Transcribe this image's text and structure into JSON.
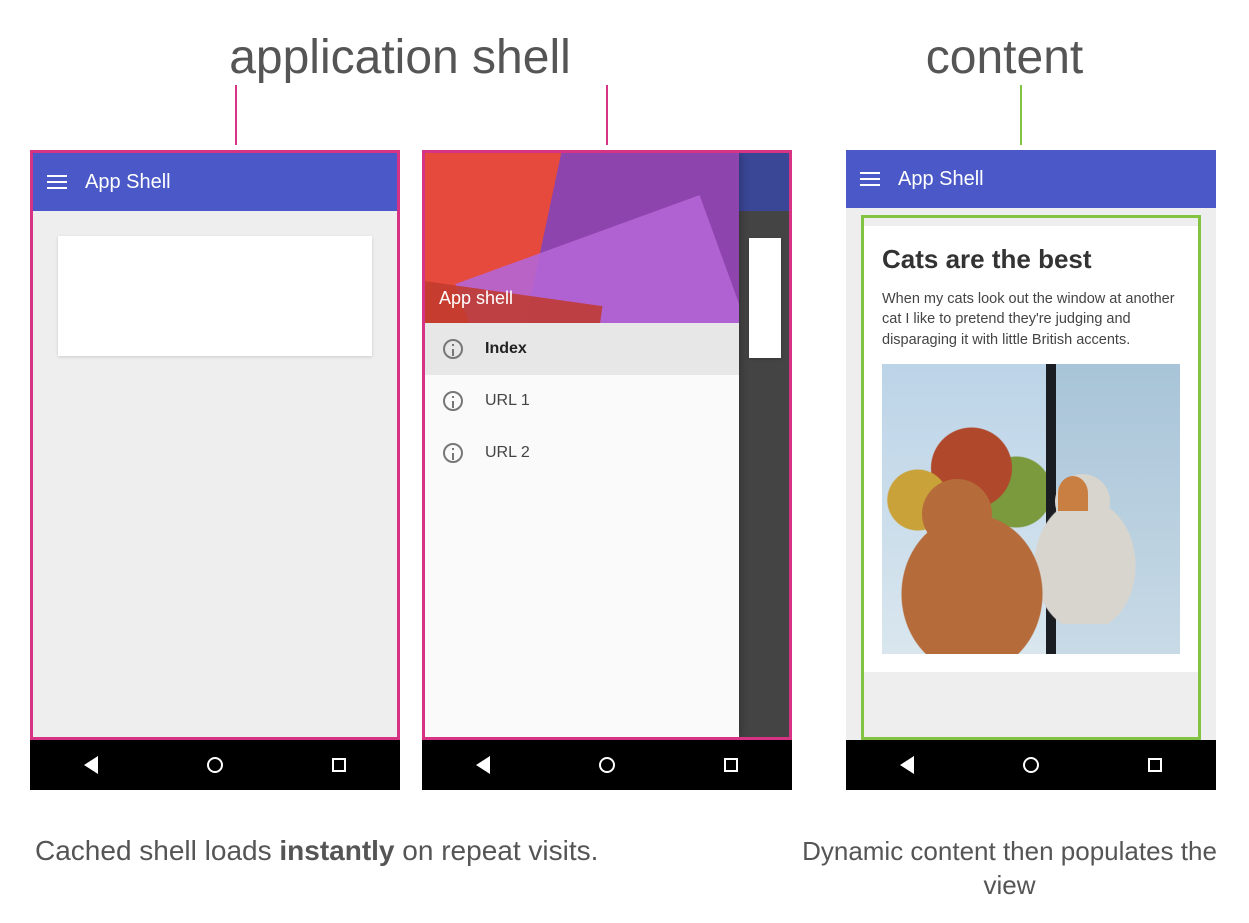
{
  "labels": {
    "application_shell": "application shell",
    "content": "content"
  },
  "phones": {
    "appbar_title": "App Shell",
    "drawer": {
      "hero_title": "App shell",
      "items": [
        {
          "label": "Index",
          "selected": true
        },
        {
          "label": "URL 1",
          "selected": false
        },
        {
          "label": "URL 2",
          "selected": false
        }
      ]
    },
    "content_screen": {
      "title": "Cats are the best",
      "body": "When my cats look out the window at another cat I like to pretend they're judging and disparaging it with little British accents."
    }
  },
  "captions": {
    "left_pre": "Cached shell loads ",
    "left_bold": "instantly",
    "left_post": " on repeat visits.",
    "right": "Dynamic content then populates the view"
  },
  "colors": {
    "frame_shell": "#d63384",
    "frame_content": "#82c341",
    "appbar": "#4a59c7"
  }
}
